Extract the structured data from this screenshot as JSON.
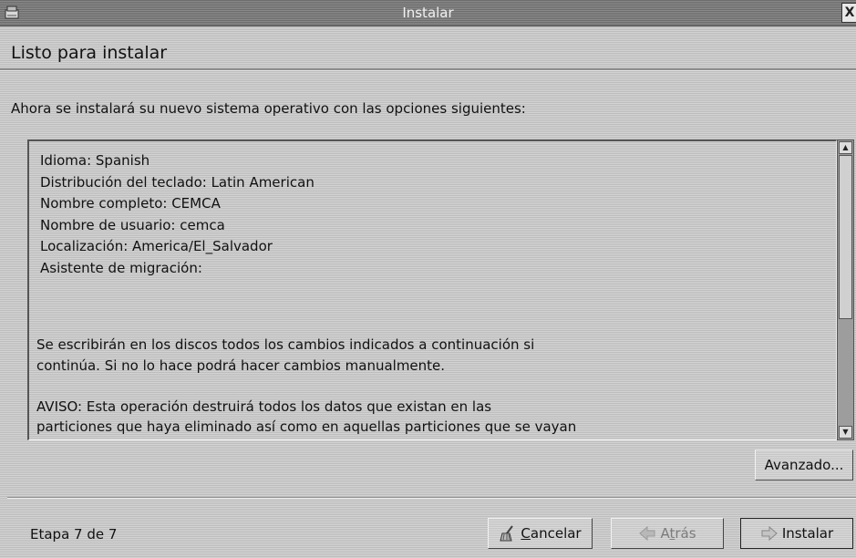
{
  "window": {
    "title": "Instalar",
    "close_symbol": "X"
  },
  "page_title": "Listo para instalar",
  "intro": "Ahora se instalará su nuevo sistema operativo con las opciones siguientes:",
  "summary": [
    "Idioma: Spanish",
    "Distribución del teclado: Latin American",
    "Nombre completo: CEMCA",
    "Nombre de usuario: cemca",
    "Localización: America/El_Salvador",
    "Asistente de migración:"
  ],
  "notice": [
    "Se escribirán en los discos todos los cambios indicados a continuación si",
    "continúa. Si no lo hace podrá hacer cambios manualmente.",
    "",
    "AVISO: Esta operación destruirá todos los datos que existan en las",
    "particiones que haya eliminado así como en aquellas particiones que se vayan"
  ],
  "buttons": {
    "advanced": "Avanzado...",
    "cancel_mnemonic": "C",
    "cancel_rest": "ancelar",
    "back_pre": "A",
    "back_mnemonic": "t",
    "back_rest": "rás",
    "install": "Instalar"
  },
  "step": "Etapa 7 de 7",
  "icons": {
    "window": "installer-window-icon",
    "cancel": "broom-icon",
    "back": "arrow-left-icon",
    "install": "arrow-right-icon"
  }
}
